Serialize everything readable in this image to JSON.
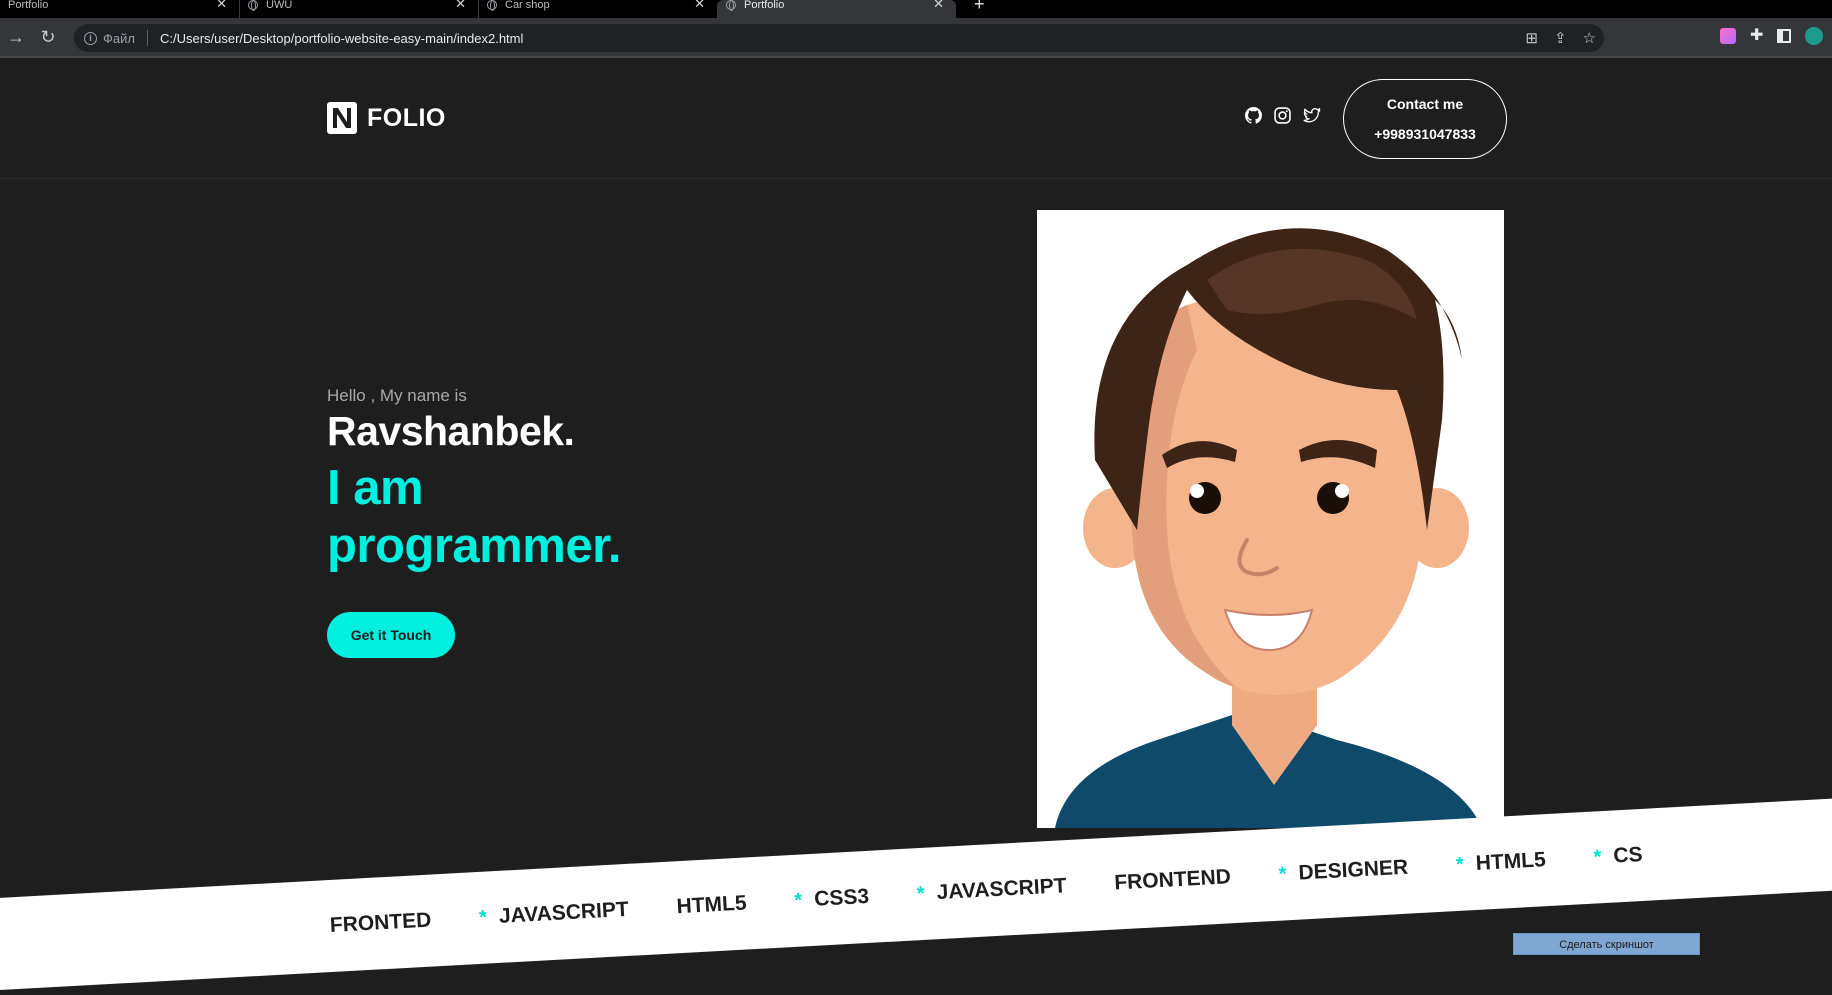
{
  "browser": {
    "tabs": [
      {
        "title": "Portfolio",
        "close": "✕",
        "active": false
      },
      {
        "title": "UWU",
        "close": "✕",
        "active": false
      },
      {
        "title": "Car shop",
        "close": "✕",
        "active": false
      },
      {
        "title": "Portfolio",
        "close": "✕",
        "active": true
      }
    ],
    "new_tab": "+",
    "address": {
      "scheme_label": "Файл",
      "url": "C:/Users/user/Desktop/portfolio-website-easy-main/index2.html"
    }
  },
  "site": {
    "logo_text": "FOLIO",
    "contact": {
      "label": "Contact me",
      "phone": "+998931047833"
    },
    "hero": {
      "greeting": "Hello , My name is",
      "name": "Ravshanbek.",
      "role": "I am programmer.",
      "cta": "Get it Touch"
    },
    "marquee": [
      "FRONTED",
      "JAVASCRIPT",
      "HTML5",
      "CSS3",
      "JAVASCRIPT",
      "FRONTEND",
      "DESIGNER",
      "HTML5",
      "CS"
    ],
    "marquee_star": "*"
  },
  "overlay": {
    "screenshot_button": "Сделать скриншот"
  },
  "colors": {
    "accent": "#00f0e0",
    "background": "#1e1e1e"
  }
}
